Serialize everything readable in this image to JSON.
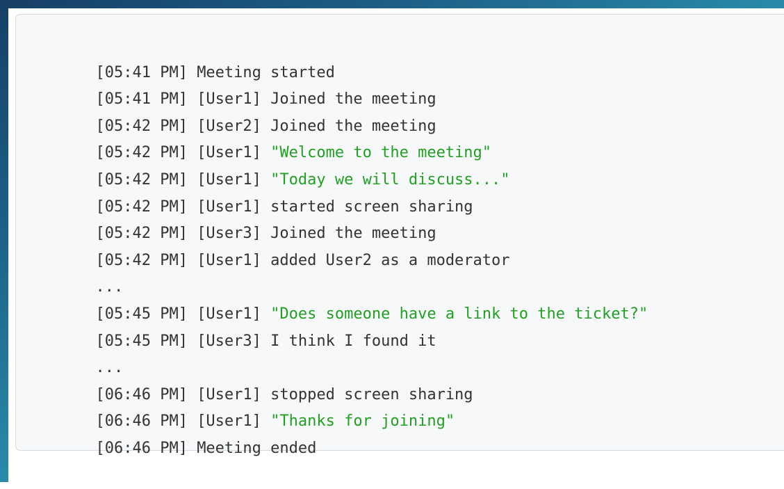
{
  "lines": [
    {
      "kind": "event",
      "time": "[05:41 PM]",
      "user": "",
      "text": "Meeting started"
    },
    {
      "kind": "event",
      "time": "[05:41 PM]",
      "user": "[User1]",
      "text": "Joined the meeting"
    },
    {
      "kind": "event",
      "time": "[05:42 PM]",
      "user": "[User2]",
      "text": "Joined the meeting"
    },
    {
      "kind": "quote",
      "time": "[05:42 PM]",
      "user": "[User1]",
      "text": "\"Welcome to the meeting\""
    },
    {
      "kind": "quote",
      "time": "[05:42 PM]",
      "user": "[User1]",
      "text": "\"Today we will discuss...\""
    },
    {
      "kind": "event",
      "time": "[05:42 PM]",
      "user": "[User1]",
      "text": "started screen sharing"
    },
    {
      "kind": "event",
      "time": "[05:42 PM]",
      "user": "[User3]",
      "text": "Joined the meeting"
    },
    {
      "kind": "event",
      "time": "[05:42 PM]",
      "user": "[User1]",
      "text": "added User2 as a moderator"
    },
    {
      "kind": "ellipsis",
      "text": "..."
    },
    {
      "kind": "quote",
      "time": "[05:45 PM]",
      "user": "[User1]",
      "text": "\"Does someone have a link to the ticket?\""
    },
    {
      "kind": "event",
      "time": "[05:45 PM]",
      "user": "[User3]",
      "text": "I think I found it"
    },
    {
      "kind": "ellipsis",
      "text": "..."
    },
    {
      "kind": "event",
      "time": "[06:46 PM]",
      "user": "[User1]",
      "text": "stopped screen sharing"
    },
    {
      "kind": "quote",
      "time": "[06:46 PM]",
      "user": "[User1]",
      "text": "\"Thanks for joining\""
    },
    {
      "kind": "event",
      "time": "[06:46 PM]",
      "user": "",
      "text": "Meeting ended"
    }
  ],
  "colors": {
    "text": "#333333",
    "quote": "#22a022",
    "panel_bg": "#f6f8fa",
    "panel_border": "#d5d8dc"
  }
}
